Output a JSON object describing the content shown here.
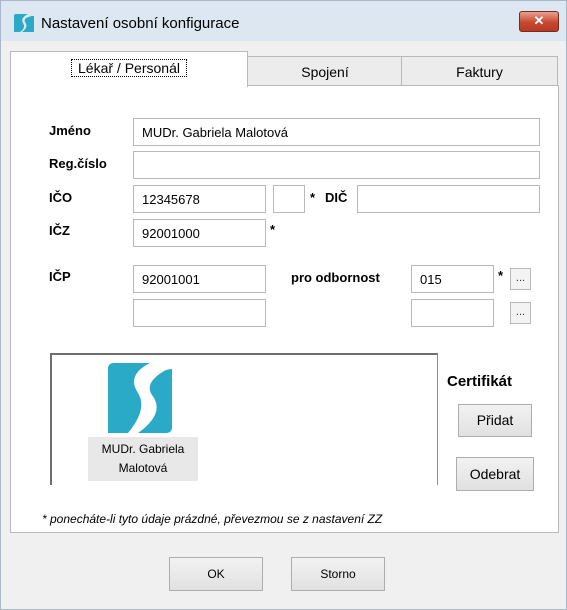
{
  "window": {
    "title": "Nastavení osobní konfigurace",
    "close_label": "✕"
  },
  "tabs": [
    {
      "label": "Lékař / Personál",
      "active": true
    },
    {
      "label": "Spojení",
      "active": false
    },
    {
      "label": "Faktury",
      "active": false
    }
  ],
  "form": {
    "jmeno_label": "Jméno",
    "jmeno_value": "MUDr. Gabriela Malotová",
    "regcislo_label": "Reg.číslo",
    "regcislo_value": "",
    "ico_label": "IČO",
    "ico_value": "12345678",
    "ico_suffix_value": "",
    "dic_label": "DIČ",
    "dic_value": "",
    "icz_label": "IČZ",
    "icz_value": "92001000",
    "icp_label": "IČP",
    "icp_value": "92001001",
    "icp2_value": "",
    "odbornost_label": "pro odbornost",
    "odbornost_value": "015",
    "odbornost2_value": "",
    "star": "*",
    "dots": "..."
  },
  "certificate": {
    "title": "Certifikát",
    "name_line1": "MUDr. Gabriela",
    "name_line2": "Malotová",
    "add_label": "Přidat",
    "remove_label": "Odebrat"
  },
  "note": "* ponecháte-li tyto údaje prázdné, převezmou se z nastavení ZZ",
  "buttons": {
    "ok": "OK",
    "storno": "Storno"
  },
  "colors": {
    "brand": "#2aaac6",
    "titlebar": "#dde7f2",
    "close": "#c8472f"
  }
}
